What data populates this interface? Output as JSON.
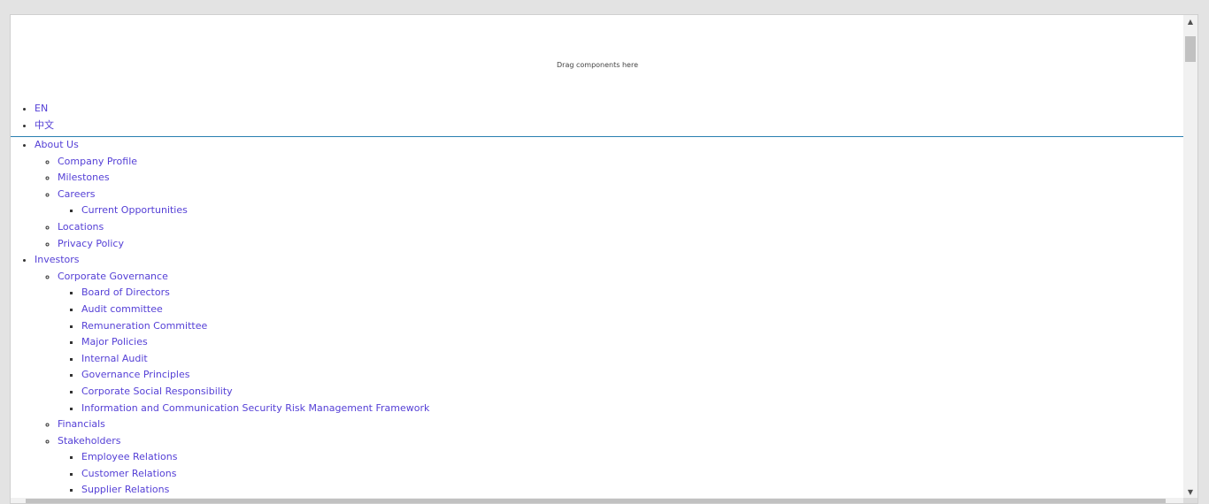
{
  "dropzone": {
    "text": "Drag components here"
  },
  "languages": [
    "EN",
    "中文"
  ],
  "nav": {
    "about": {
      "label": "About Us",
      "company_profile": "Company Profile",
      "milestones": "Milestones",
      "careers": "Careers",
      "current_opportunities": "Current Opportunities",
      "locations": "Locations",
      "privacy_policy": "Privacy Policy"
    },
    "investors": {
      "label": "Investors",
      "corporate_governance": "Corporate Governance",
      "governance_items": [
        "Board of Directors",
        "Audit committee",
        "Remuneration Committee",
        "Major Policies",
        "Internal Audit",
        "Governance Principles",
        "Corporate Social Responsibility",
        "Information and Communication Security Risk Management Framework"
      ],
      "financials": "Financials",
      "stakeholders": "Stakeholders",
      "stakeholder_items": [
        "Employee Relations",
        "Customer Relations",
        "Supplier Relations"
      ]
    }
  },
  "scroll": {
    "up_icon": "▲",
    "down_icon": "▼"
  },
  "colors": {
    "link": "#5540d6",
    "divider": "#2a7fb0",
    "background": "#e3e3e3"
  }
}
